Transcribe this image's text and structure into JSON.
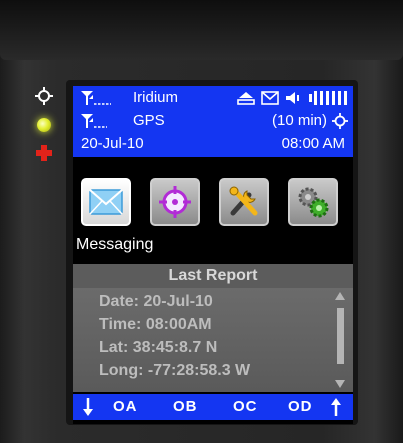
{
  "colors": {
    "status_bar": "#1436f2",
    "report_bg": "#5a5a5a",
    "led_power": "#e3ef31",
    "led_alert": "#e2231a"
  },
  "status": {
    "iridium_label": "Iridium",
    "gps_label": "GPS",
    "interval": "(10 min)",
    "date": "20-Jul-10",
    "time": "08:00 AM",
    "icons": [
      "upload-icon",
      "envelope-icon",
      "speaker-icon",
      "battery-bars-icon",
      "target-icon"
    ]
  },
  "menu": {
    "items": [
      {
        "icon": "envelope-icon"
      },
      {
        "icon": "crosshair-icon"
      },
      {
        "icon": "tools-icon"
      },
      {
        "icon": "gears-icon"
      }
    ],
    "selected_caption": "Messaging"
  },
  "report": {
    "title": "Last Report",
    "lines": [
      "Date: 20-Jul-10",
      "Time: 08:00AM",
      "Lat: 38:45:8.7 N",
      "Long: -77:28:58.3 W"
    ]
  },
  "softkeys": {
    "a": "OA",
    "b": "OB",
    "c": "OC",
    "d": "OD"
  }
}
